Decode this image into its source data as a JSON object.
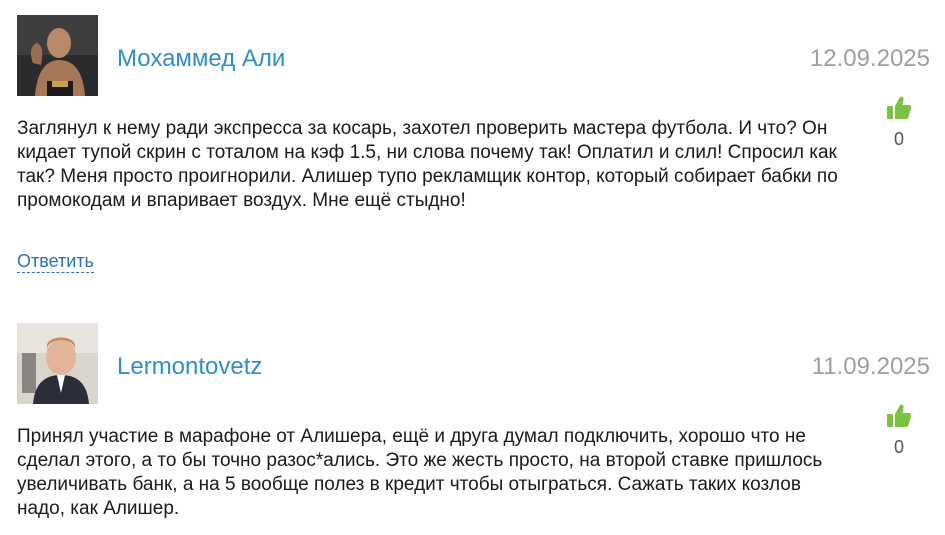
{
  "comments": [
    {
      "author": "Мохаммед Али",
      "date": "12.09.2025",
      "text": "Заглянул к нему ради экспресса за косарь, захотел проверить мастера футбола. И что? Он кидает тупой скрин с тоталом на кэф 1.5, ни слова почему так! Оплатил и слил! Спросил как так? Меня просто проигнорили. Алишер тупо рекламщик контор, который собирает бабки по промокодам и впаривает воздух. Мне ещё стыдно!",
      "likes": "0",
      "reply_label": "Ответить",
      "avatar_icon": "fighter-photo"
    },
    {
      "author": "Lermontovetz",
      "date": "11.09.2025",
      "text": "Принял участие в марафоне от Алишера, ещё и друга думал подключить, хорошо что не сделал этого, а то бы точно разос*ались. Это же жесть просто, на второй ставке пришлось увеличивать банк, а на 5 вообще полез в кредит чтобы отыграться. Сажать таких козлов надо, как Алишер.",
      "likes": "0",
      "avatar_icon": "man-in-suit-photo"
    }
  ],
  "colors": {
    "author": "#2f8fc9",
    "date": "#9aa0a6",
    "thumb": "#7cc242",
    "reply": "#2f6fb3"
  }
}
